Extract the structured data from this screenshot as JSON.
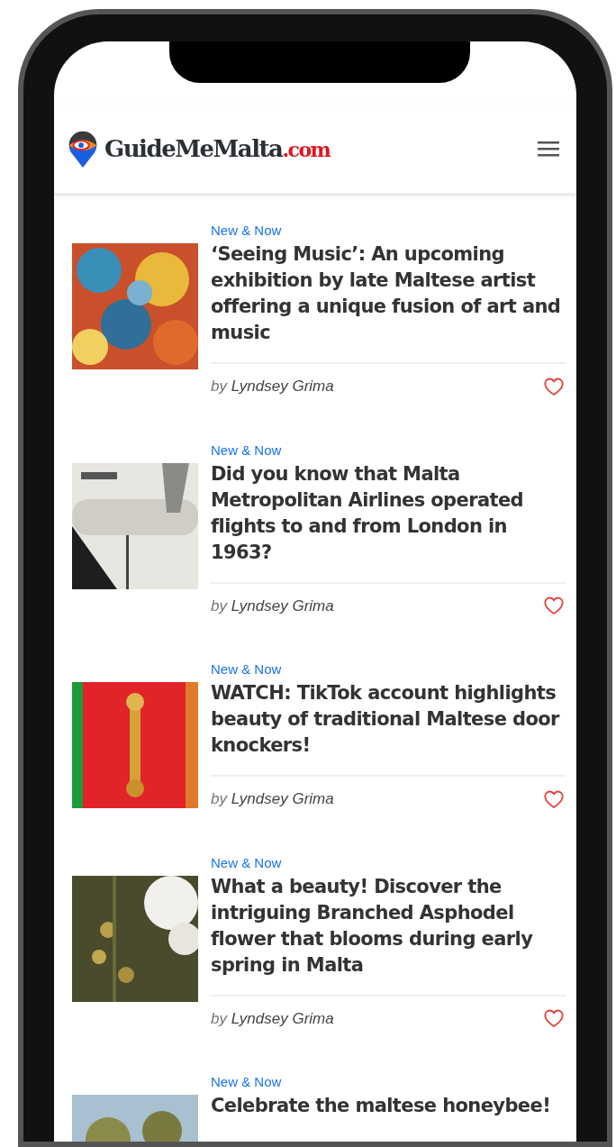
{
  "header": {
    "brand": "GuideMeMalta",
    "brand_suffix": ".com"
  },
  "articles": [
    {
      "category": "New & Now",
      "title": "‘Seeing Music’: An upcoming exhibition by late Maltese artist offering a unique fusion of art and music",
      "author_prefix": "by",
      "author": "Lyndsey Grima",
      "liked": false
    },
    {
      "category": "New & Now",
      "title": "Did you know that Malta Metropolitan Airlines operated flights to and from London in 1963?",
      "author_prefix": "by",
      "author": "Lyndsey Grima",
      "liked": false
    },
    {
      "category": "New & Now",
      "title": "WATCH: TikTok account highlights beauty of traditional Maltese door knockers!",
      "author_prefix": "by",
      "author": "Lyndsey Grima",
      "liked": false
    },
    {
      "category": "New & Now",
      "title": "What a beauty! Discover the intriguing Branched Asphodel flower that blooms during early spring in Malta",
      "author_prefix": "by",
      "author": "Lyndsey Grima",
      "liked": false
    },
    {
      "category": "New & Now",
      "title": "Celebrate the maltese honeybee!"
    }
  ]
}
